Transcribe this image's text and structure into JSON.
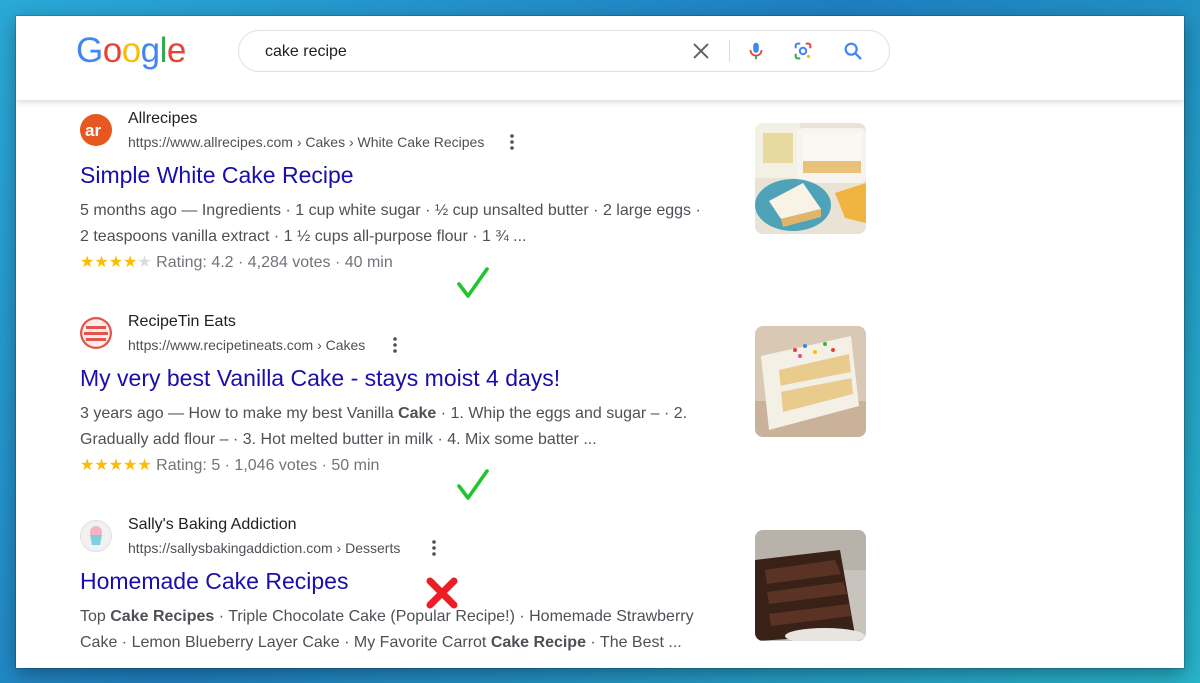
{
  "logo": {
    "text": "Google"
  },
  "search": {
    "query": "cake recipe"
  },
  "results": [
    {
      "site_name": "Allrecipes",
      "url": "https://www.allrecipes.com › Cakes › White Cake Recipes",
      "title": "Simple White Cake Recipe",
      "snippet_line1": "5 months ago — Ingredients · 1 cup white sugar · ½ cup unsalted butter · 2 large eggs ·",
      "snippet_line2": "2 teaspoons vanilla extract · 1 ½ cups all-purpose flour · 1 ¾ ...",
      "rating_text": "Rating: 4.2 · 4,284 votes · 40 min",
      "stars": 4.2,
      "mark": "check"
    },
    {
      "site_name": "RecipeTin Eats",
      "url": "https://www.recipetineats.com › Cakes",
      "title": "My very best Vanilla Cake - stays moist 4 days!",
      "snippet_line1_a": "3 years ago — How to make my best Vanilla ",
      "snippet_line1_b": "Cake",
      "snippet_line1_c": " · 1. Whip the eggs and sugar – · 2.",
      "snippet_line2": "Gradually add flour – · 3. Hot melted butter in milk · 4. Mix some batter ...",
      "rating_text": "Rating: 5 · 1,046 votes · 50 min",
      "stars": 5,
      "mark": "check"
    },
    {
      "site_name": "Sally's Baking Addiction",
      "url": "https://sallysbakingaddiction.com › Desserts",
      "title": "Homemade Cake Recipes",
      "snippet_line1_a": "Top ",
      "snippet_line1_b": "Cake Recipes",
      "snippet_line1_c": " · Triple Chocolate Cake (Popular Recipe!) · Homemade Strawberry",
      "snippet_line2_a": "Cake · Lemon Blueberry Layer Cake · My Favorite Carrot ",
      "snippet_line2_b": "Cake Recipe",
      "snippet_line2_c": " · The Best ...",
      "mark": "cross"
    }
  ],
  "colors": {
    "link": "#1a0dab",
    "check": "#22c42e",
    "cross": "#ee1c25",
    "star": "#fbbc04"
  }
}
